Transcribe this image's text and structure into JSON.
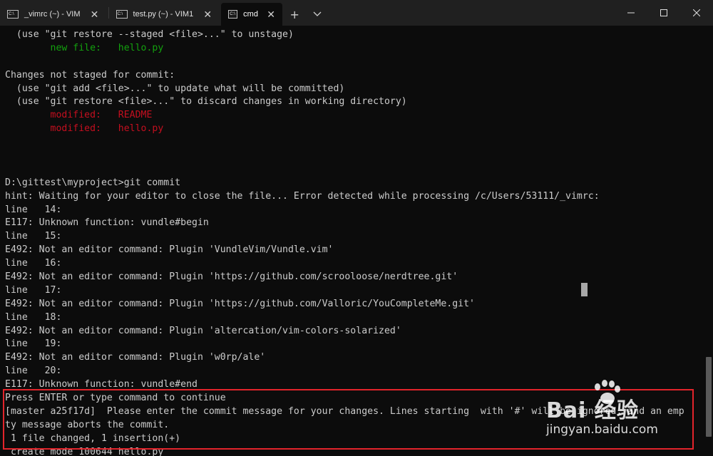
{
  "tabs": [
    {
      "label": "_vimrc (~) - VIM",
      "active": false
    },
    {
      "label": "test.py (~) - VIM1",
      "active": false
    },
    {
      "label": "cmd",
      "active": true
    }
  ],
  "icons": {
    "tab_icon": "terminal-icon",
    "close": "close-icon",
    "new_tab": "plus-icon",
    "dropdown": "chevron-down-icon",
    "minimize": "minimize-icon",
    "maximize": "maximize-icon",
    "close_window": "close-window-icon"
  },
  "terminal": {
    "lines": [
      {
        "text": "  (use \"git restore --staged <file>...\" to unstage)",
        "color": "default"
      },
      {
        "text": "        new file:   hello.py",
        "color": "green"
      },
      {
        "text": "",
        "color": "default"
      },
      {
        "text": "Changes not staged for commit:",
        "color": "default"
      },
      {
        "text": "  (use \"git add <file>...\" to update what will be committed)",
        "color": "default"
      },
      {
        "text": "  (use \"git restore <file>...\" to discard changes in working directory)",
        "color": "default"
      },
      {
        "text": "        modified:   README",
        "color": "red"
      },
      {
        "text": "        modified:   hello.py",
        "color": "red"
      },
      {
        "text": "",
        "color": "default"
      },
      {
        "text": "",
        "color": "default"
      },
      {
        "text": "",
        "color": "default"
      },
      {
        "text": "D:\\gittest\\myproject>git commit",
        "color": "default"
      },
      {
        "text": "hint: Waiting for your editor to close the file... Error detected while processing /c/Users/53111/_vimrc:",
        "color": "default"
      },
      {
        "text": "line   14:",
        "color": "default"
      },
      {
        "text": "E117: Unknown function: vundle#begin",
        "color": "default"
      },
      {
        "text": "line   15:",
        "color": "default"
      },
      {
        "text": "E492: Not an editor command: Plugin 'VundleVim/Vundle.vim'",
        "color": "default"
      },
      {
        "text": "line   16:",
        "color": "default"
      },
      {
        "text": "E492: Not an editor command: Plugin 'https://github.com/scrooloose/nerdtree.git'",
        "color": "default"
      },
      {
        "text": "line   17:",
        "color": "default"
      },
      {
        "text": "E492: Not an editor command: Plugin 'https://github.com/Valloric/YouCompleteMe.git'",
        "color": "default"
      },
      {
        "text": "line   18:",
        "color": "default"
      },
      {
        "text": "E492: Not an editor command: Plugin 'altercation/vim-colors-solarized'",
        "color": "default"
      },
      {
        "text": "line   19:",
        "color": "default"
      },
      {
        "text": "E492: Not an editor command: Plugin 'w0rp/ale'",
        "color": "default"
      },
      {
        "text": "line   20:",
        "color": "default"
      },
      {
        "text": "E117: Unknown function: vundle#end",
        "color": "default"
      },
      {
        "text": "Press ENTER or type command to continue",
        "color": "default"
      },
      {
        "text": "[master a25f17d]  Please enter the commit message for your changes. Lines starting  with '#' will be ignored, and an emp",
        "color": "default"
      },
      {
        "text": "ty message aborts the commit.",
        "color": "default"
      },
      {
        "text": " 1 file changed, 1 insertion(+)",
        "color": "default"
      },
      {
        "text": " create mode 100644 hello.py",
        "color": "default"
      }
    ]
  },
  "colors": {
    "background": "#0c0c0c",
    "text": "#cccccc",
    "green": "#13a10e",
    "red": "#c50f1f",
    "highlight": "#e3242b"
  },
  "watermark": {
    "logo_text": "Bai 经验",
    "url": "jingyan.baidu.com"
  }
}
